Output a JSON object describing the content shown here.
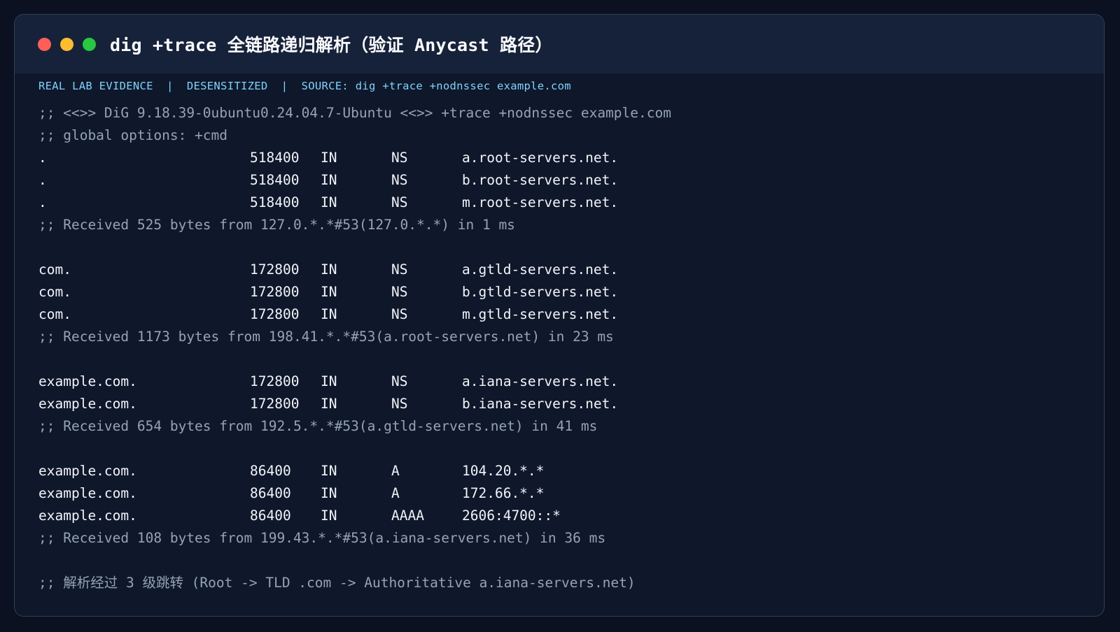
{
  "window": {
    "title": "dig +trace 全链路递归解析（验证 Anycast 路径）"
  },
  "source_line": "REAL LAB EVIDENCE  |  DESENSITIZED  |  SOURCE: dig +trace +nodnssec example.com",
  "terminal": {
    "lines": [
      {
        "kind": "comment",
        "text": ";; <<>> DiG 9.18.39-0ubuntu0.24.04.7-Ubuntu <<>> +trace +nodnssec example.com"
      },
      {
        "kind": "comment",
        "text": ";; global options: +cmd"
      },
      {
        "kind": "record",
        "name": ".",
        "ttl": "518400",
        "class": "IN",
        "type": "NS",
        "value": "a.root-servers.net."
      },
      {
        "kind": "record",
        "name": ".",
        "ttl": "518400",
        "class": "IN",
        "type": "NS",
        "value": "b.root-servers.net."
      },
      {
        "kind": "record",
        "name": ".",
        "ttl": "518400",
        "class": "IN",
        "type": "NS",
        "value": "m.root-servers.net."
      },
      {
        "kind": "comment",
        "text": ";; Received 525 bytes from 127.0.*.*#53(127.0.*.*) in 1 ms"
      },
      {
        "kind": "blank"
      },
      {
        "kind": "record",
        "name": "com.",
        "ttl": "172800",
        "class": "IN",
        "type": "NS",
        "value": "a.gtld-servers.net."
      },
      {
        "kind": "record",
        "name": "com.",
        "ttl": "172800",
        "class": "IN",
        "type": "NS",
        "value": "b.gtld-servers.net."
      },
      {
        "kind": "record",
        "name": "com.",
        "ttl": "172800",
        "class": "IN",
        "type": "NS",
        "value": "m.gtld-servers.net."
      },
      {
        "kind": "comment",
        "text": ";; Received 1173 bytes from 198.41.*.*#53(a.root-servers.net) in 23 ms"
      },
      {
        "kind": "blank"
      },
      {
        "kind": "record",
        "name": "example.com.",
        "ttl": "172800",
        "class": "IN",
        "type": "NS",
        "value": "a.iana-servers.net."
      },
      {
        "kind": "record",
        "name": "example.com.",
        "ttl": "172800",
        "class": "IN",
        "type": "NS",
        "value": "b.iana-servers.net."
      },
      {
        "kind": "comment",
        "text": ";; Received 654 bytes from 192.5.*.*#53(a.gtld-servers.net) in 41 ms"
      },
      {
        "kind": "blank"
      },
      {
        "kind": "record",
        "name": "example.com.",
        "ttl": "86400",
        "class": "IN",
        "type": "A",
        "value": "104.20.*.*"
      },
      {
        "kind": "record",
        "name": "example.com.",
        "ttl": "86400",
        "class": "IN",
        "type": "A",
        "value": "172.66.*.*"
      },
      {
        "kind": "record",
        "name": "example.com.",
        "ttl": "86400",
        "class": "IN",
        "type": "AAAA",
        "value": "2606:4700::*"
      },
      {
        "kind": "comment",
        "text": ";; Received 108 bytes from 199.43.*.*#53(a.iana-servers.net) in 36 ms"
      },
      {
        "kind": "blank"
      },
      {
        "kind": "comment",
        "text": ";; 解析经过 3 级跳转 (Root -> TLD .com -> Authoritative a.iana-servers.net)"
      }
    ]
  },
  "colors": {
    "page_background": "#0b1120",
    "window_background": "#0f172a",
    "titlebar_background": "#16213a",
    "source_text": "#7dd3fc",
    "record_text": "#f1f5f9",
    "comment_text": "#94a3b8",
    "close_dot": "#ff5f57",
    "minimize_dot": "#febc2e",
    "maximize_dot": "#28c840"
  }
}
